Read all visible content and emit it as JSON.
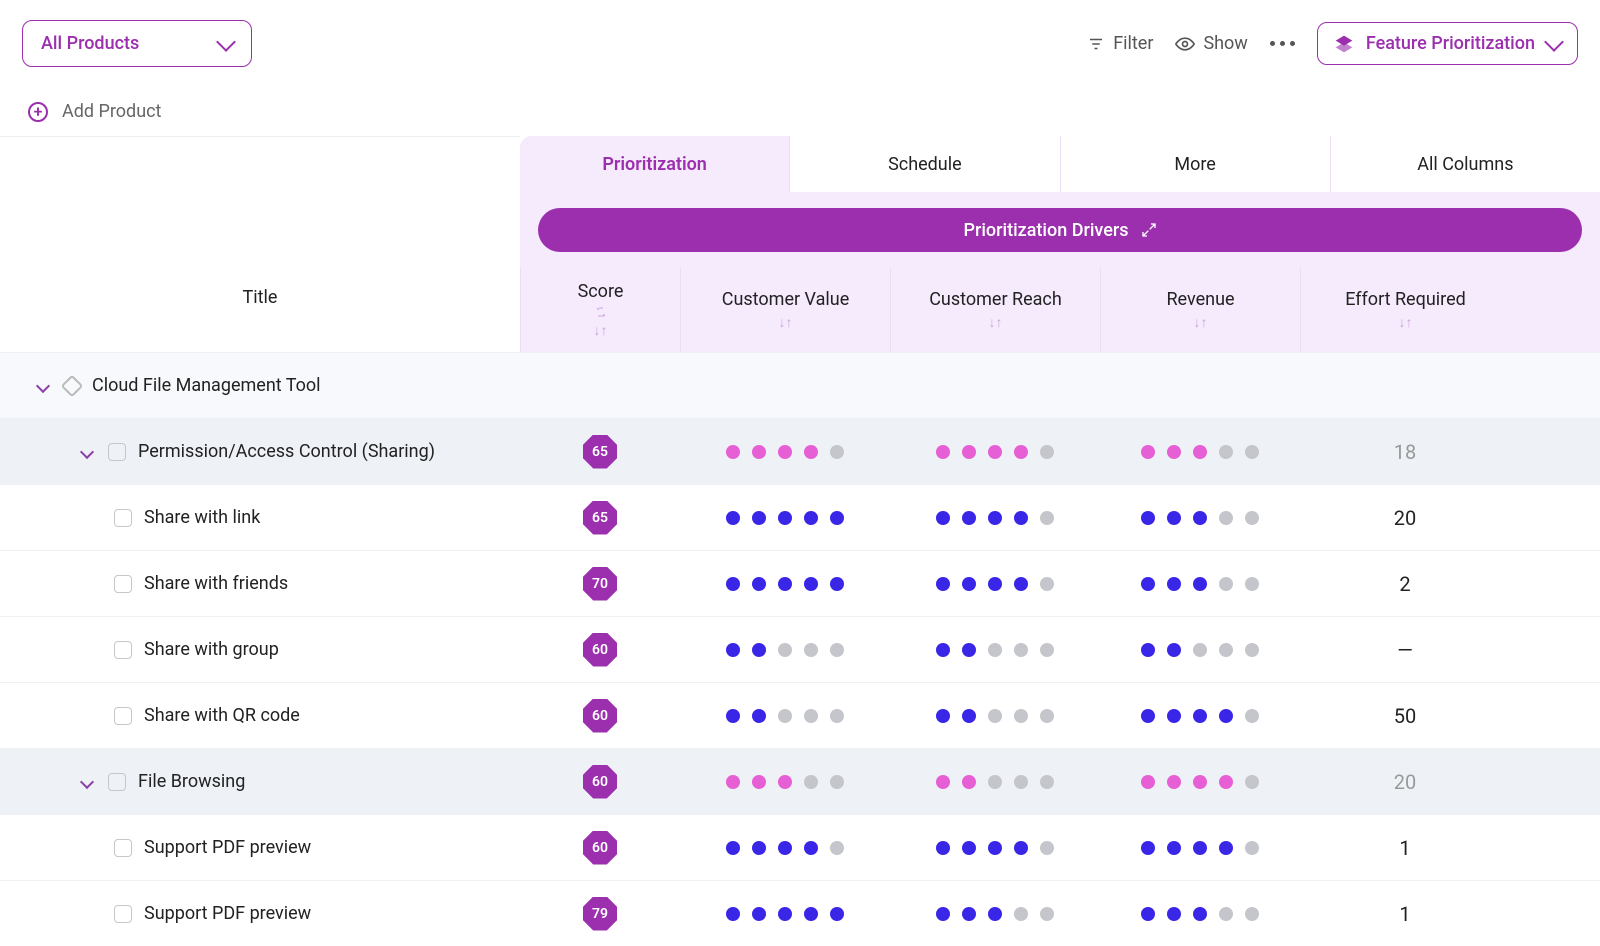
{
  "header": {
    "product_selector": "All Products",
    "filter_label": "Filter",
    "show_label": "Show",
    "view_label": "Feature Prioritization"
  },
  "add_product_label": "Add Product",
  "title_col": "Title",
  "tabs": [
    "Prioritization",
    "Schedule",
    "More",
    "All Columns"
  ],
  "drivers_btn": "Prioritization Drivers",
  "columns": [
    "Score",
    "Customer Value",
    "Customer Reach",
    "Revenue",
    "Effort Required"
  ],
  "rows": [
    {
      "type": "group",
      "indent": 1,
      "title": "Cloud File Management Tool",
      "caret": true,
      "hex": true
    },
    {
      "type": "parent",
      "indent": 2,
      "title": "Permission/Access Control (Sharing)",
      "caret": true,
      "chk": true,
      "score": 65,
      "cv": 4,
      "cr": 4,
      "rev": 3,
      "eff": "18",
      "pink": true,
      "muted": true
    },
    {
      "type": "item",
      "indent": 3,
      "title": "Share with link",
      "chk": true,
      "score": 65,
      "cv": 5,
      "cr": 4,
      "rev": 3,
      "eff": "20"
    },
    {
      "type": "item",
      "indent": 3,
      "title": "Share with friends",
      "chk": true,
      "score": 70,
      "cv": 5,
      "cr": 4,
      "rev": 3,
      "eff": "2"
    },
    {
      "type": "item",
      "indent": 3,
      "title": "Share with group",
      "chk": true,
      "score": 60,
      "cv": 2,
      "cr": 2,
      "rev": 2,
      "eff": "—"
    },
    {
      "type": "item",
      "indent": 3,
      "title": "Share with QR code",
      "chk": true,
      "score": 60,
      "cv": 2,
      "cr": 2,
      "rev": 4,
      "eff": "50"
    },
    {
      "type": "parent",
      "indent": 2,
      "title": "File Browsing",
      "caret": true,
      "chk": true,
      "score": 60,
      "cv": 3,
      "cr": 2,
      "rev": 4,
      "eff": "20",
      "pink": true,
      "muted": true
    },
    {
      "type": "item",
      "indent": 3,
      "title": "Support PDF preview",
      "chk": true,
      "score": 60,
      "cv": 4,
      "cr": 4,
      "rev": 4,
      "eff": "1"
    },
    {
      "type": "item",
      "indent": 3,
      "title": "Support PDF preview",
      "chk": true,
      "score": 79,
      "cv": 5,
      "cr": 3,
      "rev": 3,
      "eff": "1"
    }
  ]
}
